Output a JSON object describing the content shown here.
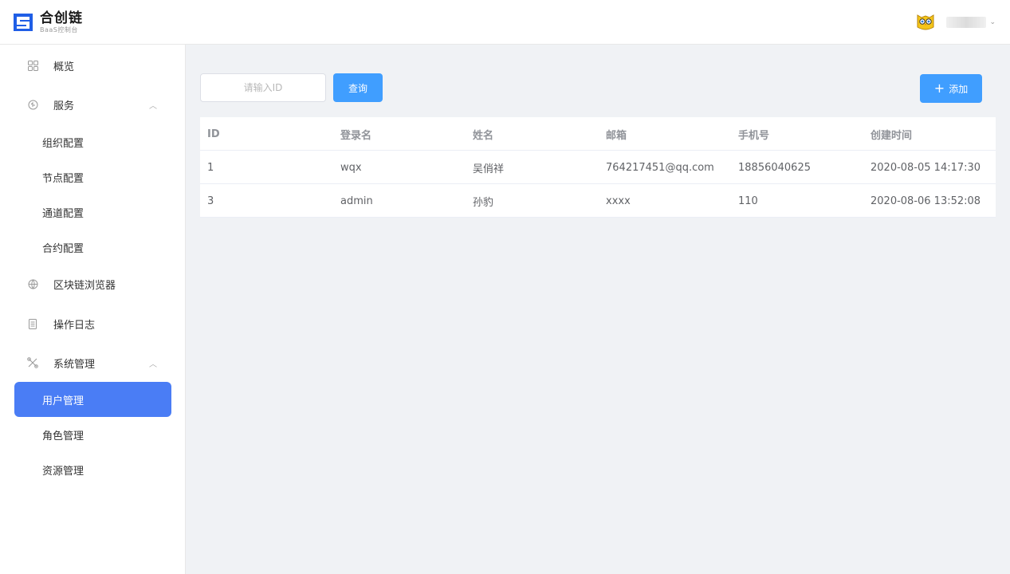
{
  "header": {
    "logo_title": "合创链",
    "logo_subtitle": "BaaS控制台",
    "avatar_icon": "owl-avatar-icon",
    "username": ""
  },
  "sidebar": {
    "items": [
      {
        "label": "概览",
        "icon": "grid-icon",
        "type": "item"
      },
      {
        "label": "服务",
        "icon": "service-icon",
        "type": "group",
        "expanded": true
      },
      {
        "label": "组织配置",
        "type": "sub"
      },
      {
        "label": "节点配置",
        "type": "sub"
      },
      {
        "label": "通道配置",
        "type": "sub"
      },
      {
        "label": "合约配置",
        "type": "sub"
      },
      {
        "label": "区块链浏览器",
        "icon": "globe-icon",
        "type": "item"
      },
      {
        "label": "操作日志",
        "icon": "log-icon",
        "type": "item"
      },
      {
        "label": "系统管理",
        "icon": "tools-icon",
        "type": "group",
        "expanded": true
      },
      {
        "label": "用户管理",
        "type": "sub",
        "active": true
      },
      {
        "label": "角色管理",
        "type": "sub"
      },
      {
        "label": "资源管理",
        "type": "sub"
      }
    ]
  },
  "toolbar": {
    "search_placeholder": "请输入ID",
    "search_value": "",
    "query_label": "查询",
    "add_label": "添加"
  },
  "table": {
    "columns": [
      "ID",
      "登录名",
      "姓名",
      "邮箱",
      "手机号",
      "创建时间"
    ],
    "rows": [
      [
        "1",
        "wqx",
        "吴俏祥",
        "764217451@qq.com",
        "18856040625",
        "2020-08-05 14:17:30"
      ],
      [
        "3",
        "admin",
        "孙豹",
        "xxxx",
        "110",
        "2020-08-06 13:52:08"
      ]
    ]
  },
  "colors": {
    "primary": "#409eff",
    "active_menu": "#4a7df5",
    "page_bg": "#f0f2f5"
  }
}
